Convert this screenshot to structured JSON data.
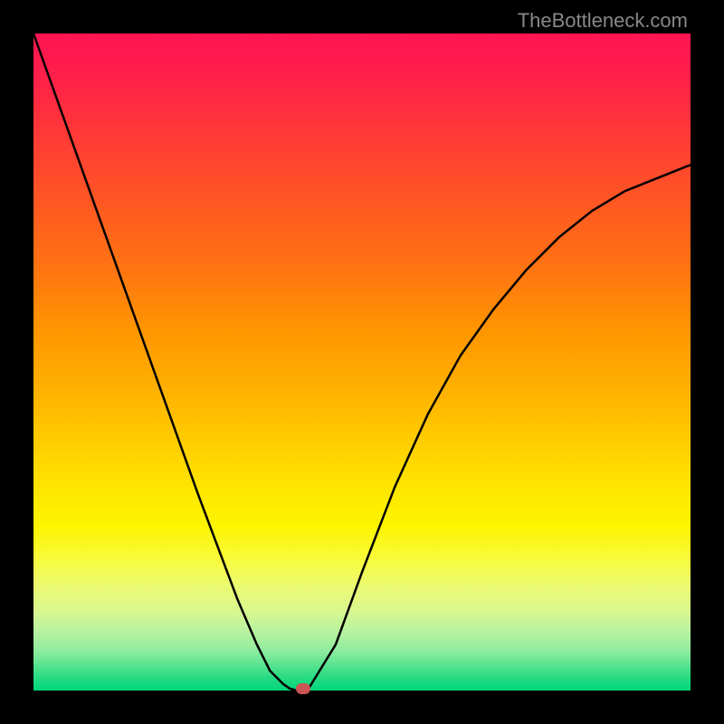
{
  "watermark": "TheBottleneck.com",
  "chart_data": {
    "type": "line",
    "title": "",
    "xlabel": "",
    "ylabel": "",
    "xlim": [
      0,
      100
    ],
    "ylim": [
      0,
      100
    ],
    "series": [
      {
        "name": "bottleneck-curve",
        "x": [
          0,
          5,
          10,
          15,
          20,
          25,
          28,
          31,
          34,
          36,
          38,
          39,
          40,
          41,
          41.5,
          42,
          46,
          50,
          55,
          60,
          65,
          70,
          75,
          80,
          85,
          90,
          95,
          100
        ],
        "values": [
          100,
          86,
          72,
          58,
          44,
          30,
          22,
          14,
          7,
          3,
          1,
          0.3,
          0,
          0,
          0,
          0.5,
          7,
          18,
          31,
          42,
          51,
          58,
          64,
          69,
          73,
          76,
          78,
          80
        ]
      }
    ],
    "marker": {
      "x": 41,
      "y": 0,
      "color": "#cc5555"
    },
    "gradient": {
      "top": "#ff1453",
      "bottom": "#00d67c"
    }
  }
}
